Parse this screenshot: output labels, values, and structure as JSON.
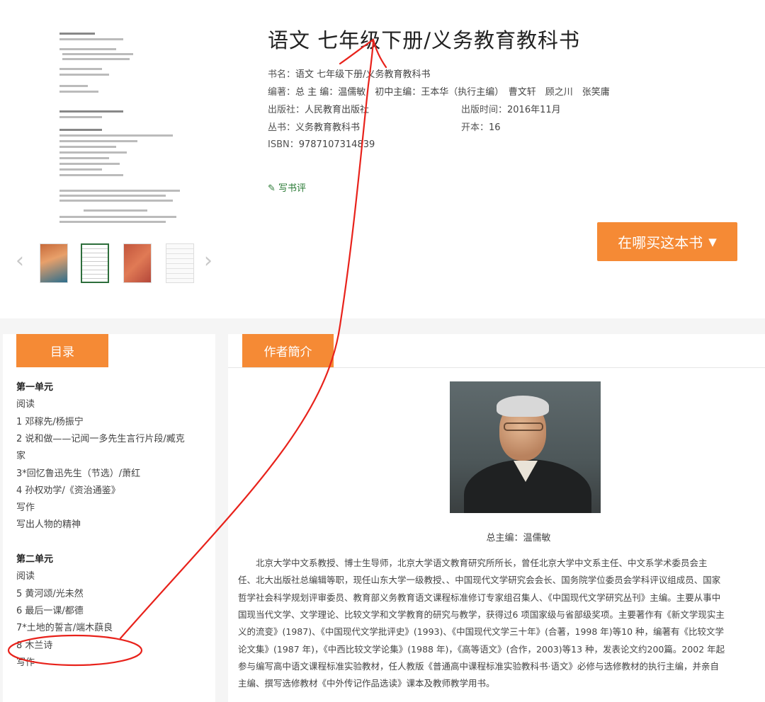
{
  "book": {
    "title": "语文 七年级下册/义务教育教科书",
    "meta": {
      "name_label": "书名：",
      "name_value": "语文 七年级下册/义务教育教科书",
      "author_label": "编著：",
      "author_value": "总 主 编：温儒敏　初中主编：王本华（执行主编）　曹文轩　顾之川　张笑庸",
      "publisher_label": "出版社：",
      "publisher_value": "人民教育出版社",
      "pubdate_label": "出版时间：",
      "pubdate_value": "2016年11月",
      "series_label": "丛书：",
      "series_value": "义务教育教科书",
      "format_label": "开本：",
      "format_value": "16",
      "isbn_label": "ISBN：",
      "isbn_value": "9787107314839"
    },
    "review_link": "写书评",
    "buy_button": "在哪买这本书"
  },
  "toc": {
    "tab_label": "目录",
    "lines": [
      {
        "text": "第一单元",
        "type": "unit"
      },
      {
        "text": "阅读",
        "type": "section"
      },
      {
        "text": " 1 邓稼先/杨振宁",
        "type": "item"
      },
      {
        "text": " 2 说和做——记闻一多先生言行片段/臧克",
        "type": "item"
      },
      {
        "text": "家",
        "type": "item"
      },
      {
        "text": " 3*回忆鲁迅先生（节选）/萧红",
        "type": "item"
      },
      {
        "text": " 4 孙权劝学/《资治通鉴》",
        "type": "item"
      },
      {
        "text": "写作",
        "type": "section"
      },
      {
        "text": " 写出人物的精神",
        "type": "item"
      },
      {
        "text": "",
        "type": "blank"
      },
      {
        "text": "第二单元",
        "type": "unit"
      },
      {
        "text": "阅读",
        "type": "section"
      },
      {
        "text": " 5 黄河颂/光未然",
        "type": "item"
      },
      {
        "text": " 6 最后一课/都德",
        "type": "item"
      },
      {
        "text": " 7*土地的誓言/端木蕻良",
        "type": "item"
      },
      {
        "text": " 8 木兰诗",
        "type": "item"
      },
      {
        "text": "写作",
        "type": "section"
      }
    ]
  },
  "author": {
    "tab_label": "作者簡介",
    "caption": "总主编：温儒敏",
    "bio_lines": [
      "　　北京大学中文系教授、博士生导师，北京大学语文教育研究所所长，曾任北京大学中文系主任、中文系学术委员会主",
      "任、北大出版社总编辑等职，现任山东大学一级教授、、中国现代文学研究会会长、国务院学位委员会学科评议组成员、国家",
      "哲学社会科学规划评审委员、教育部义务教育语文课程标准修订专家组召集人、《中国现代文学研究丛刊》主编。主要从事中",
      "国现当代文学、文学理论、比较文学和文学教育的研究与教学，获得过6 项国家级与省部级奖项。主要著作有《新文学现实主",
      "义的流变》(1987)、《中国现代文学批评史》(1993)、《中国现代文学三十年》(合著，1998 年)等10 种，编著有《比较文学",
      "论文集》(1987 年)，《中西比较文学论集》(1988 年)，《高等语文》(合作，2003)等13 种，发表论文约200篇。2002 年起",
      "参与编写高中语文课程标准实验教材，任人教版《普通高中课程标准实验教科书·语文》必修与选修教材的执行主编，并亲自",
      "主编、撰写选修教材《中外传记作品选读》课本及教师教学用书。"
    ]
  },
  "colors": {
    "accent": "#f58a35",
    "link": "#2a7a35",
    "annotation": "#e8221b"
  },
  "icons": {
    "pencil": "pencil-icon",
    "caret": "caret-down-icon",
    "prev": "chevron-left-icon",
    "next": "chevron-right-icon"
  }
}
